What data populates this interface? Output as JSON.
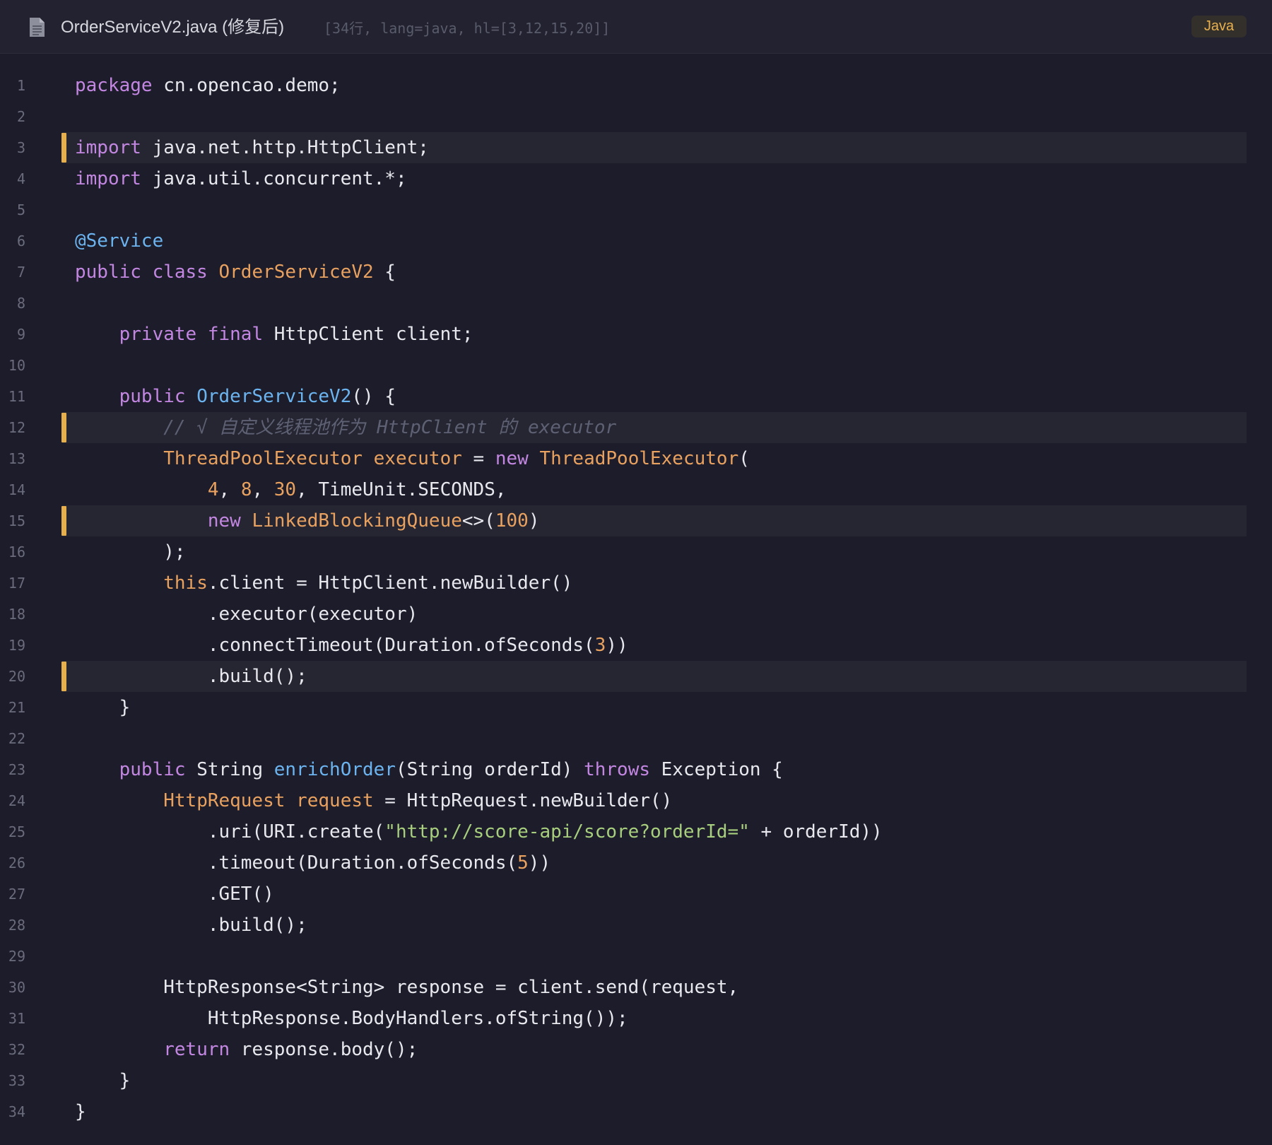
{
  "header": {
    "file_icon": "file-icon",
    "title": "OrderServiceV2.java (修复后)",
    "meta": "[34行, lang=java, hl=[3,12,15,20]]",
    "language_badge": "Java"
  },
  "colors": {
    "background": "#1c1c2a",
    "header_background": "#222231",
    "highlight_bar": "#e8b04d",
    "keyword": "#c387e2",
    "type": "#e9a15f",
    "function": "#6cb4f0",
    "string": "#a8cf7d",
    "comment": "#5e6073"
  },
  "code": {
    "highlighted_lines": [
      3,
      12,
      15,
      20
    ],
    "lines": [
      {
        "n": "1",
        "tokens": [
          [
            "kw",
            "package"
          ],
          [
            "p",
            " cn.opencao.demo;"
          ]
        ]
      },
      {
        "n": "2",
        "tokens": []
      },
      {
        "n": "3",
        "tokens": [
          [
            "kw",
            "import"
          ],
          [
            "p",
            " java.net.http.HttpClient;"
          ]
        ]
      },
      {
        "n": "4",
        "tokens": [
          [
            "kw",
            "import"
          ],
          [
            "p",
            " java.util.concurrent.*;"
          ]
        ]
      },
      {
        "n": "5",
        "tokens": []
      },
      {
        "n": "6",
        "tokens": [
          [
            "anno",
            "@Service"
          ]
        ]
      },
      {
        "n": "7",
        "tokens": [
          [
            "kw",
            "public class"
          ],
          [
            "p",
            " "
          ],
          [
            "type",
            "OrderServiceV2"
          ],
          [
            "p",
            " {"
          ]
        ]
      },
      {
        "n": "8",
        "tokens": []
      },
      {
        "n": "9",
        "tokens": [
          [
            "p",
            "    "
          ],
          [
            "kw",
            "private final"
          ],
          [
            "p",
            " HttpClient client;"
          ]
        ]
      },
      {
        "n": "10",
        "tokens": []
      },
      {
        "n": "11",
        "tokens": [
          [
            "p",
            "    "
          ],
          [
            "kw",
            "public"
          ],
          [
            "p",
            " "
          ],
          [
            "fn",
            "OrderServiceV2"
          ],
          [
            "p",
            "() {"
          ]
        ]
      },
      {
        "n": "12",
        "tokens": [
          [
            "p",
            "        "
          ],
          [
            "com",
            "// √ 自定义线程池作为 HttpClient 的 executor"
          ]
        ]
      },
      {
        "n": "13",
        "tokens": [
          [
            "p",
            "        "
          ],
          [
            "type",
            "ThreadPoolExecutor executor"
          ],
          [
            "p",
            " = "
          ],
          [
            "kw",
            "new"
          ],
          [
            "p",
            " "
          ],
          [
            "type",
            "ThreadPoolExecutor"
          ],
          [
            "p",
            "("
          ]
        ]
      },
      {
        "n": "14",
        "tokens": [
          [
            "p",
            "            "
          ],
          [
            "num",
            "4"
          ],
          [
            "p",
            ", "
          ],
          [
            "num",
            "8"
          ],
          [
            "p",
            ", "
          ],
          [
            "num",
            "30"
          ],
          [
            "p",
            ", TimeUnit.SECONDS,"
          ]
        ]
      },
      {
        "n": "15",
        "tokens": [
          [
            "p",
            "            "
          ],
          [
            "kw",
            "new"
          ],
          [
            "p",
            " "
          ],
          [
            "type",
            "LinkedBlockingQueue"
          ],
          [
            "p",
            "<>("
          ],
          [
            "num",
            "100"
          ],
          [
            "p",
            ")"
          ]
        ]
      },
      {
        "n": "16",
        "tokens": [
          [
            "p",
            "        );"
          ]
        ]
      },
      {
        "n": "17",
        "tokens": [
          [
            "p",
            "        "
          ],
          [
            "type",
            "this"
          ],
          [
            "p",
            ".client = HttpClient.newBuilder()"
          ]
        ]
      },
      {
        "n": "18",
        "tokens": [
          [
            "p",
            "            .executor(executor)"
          ]
        ]
      },
      {
        "n": "19",
        "tokens": [
          [
            "p",
            "            .connectTimeout(Duration.ofSeconds("
          ],
          [
            "num",
            "3"
          ],
          [
            "p",
            "))"
          ]
        ]
      },
      {
        "n": "20",
        "tokens": [
          [
            "p",
            "            .build();"
          ]
        ]
      },
      {
        "n": "21",
        "tokens": [
          [
            "p",
            "    }"
          ]
        ]
      },
      {
        "n": "22",
        "tokens": []
      },
      {
        "n": "23",
        "tokens": [
          [
            "p",
            "    "
          ],
          [
            "kw",
            "public"
          ],
          [
            "p",
            " String "
          ],
          [
            "fn",
            "enrichOrder"
          ],
          [
            "p",
            "(String orderId) "
          ],
          [
            "kw",
            "throws"
          ],
          [
            "p",
            " Exception {"
          ]
        ]
      },
      {
        "n": "24",
        "tokens": [
          [
            "p",
            "        "
          ],
          [
            "type",
            "HttpRequest request"
          ],
          [
            "p",
            " = HttpRequest.newBuilder()"
          ]
        ]
      },
      {
        "n": "25",
        "tokens": [
          [
            "p",
            "            .uri(URI.create("
          ],
          [
            "str",
            "\"http://score-api/score?orderId=\""
          ],
          [
            "p",
            " + orderId))"
          ]
        ]
      },
      {
        "n": "26",
        "tokens": [
          [
            "p",
            "            .timeout(Duration.ofSeconds("
          ],
          [
            "num",
            "5"
          ],
          [
            "p",
            "))"
          ]
        ]
      },
      {
        "n": "27",
        "tokens": [
          [
            "p",
            "            .GET()"
          ]
        ]
      },
      {
        "n": "28",
        "tokens": [
          [
            "p",
            "            .build();"
          ]
        ]
      },
      {
        "n": "29",
        "tokens": []
      },
      {
        "n": "30",
        "tokens": [
          [
            "p",
            "        HttpResponse<String> response = client.send(request,"
          ]
        ]
      },
      {
        "n": "31",
        "tokens": [
          [
            "p",
            "            HttpResponse.BodyHandlers.ofString());"
          ]
        ]
      },
      {
        "n": "32",
        "tokens": [
          [
            "p",
            "        "
          ],
          [
            "kw",
            "return"
          ],
          [
            "p",
            " response.body();"
          ]
        ]
      },
      {
        "n": "33",
        "tokens": [
          [
            "p",
            "    }"
          ]
        ]
      },
      {
        "n": "34",
        "tokens": [
          [
            "p",
            "}"
          ]
        ]
      }
    ]
  }
}
